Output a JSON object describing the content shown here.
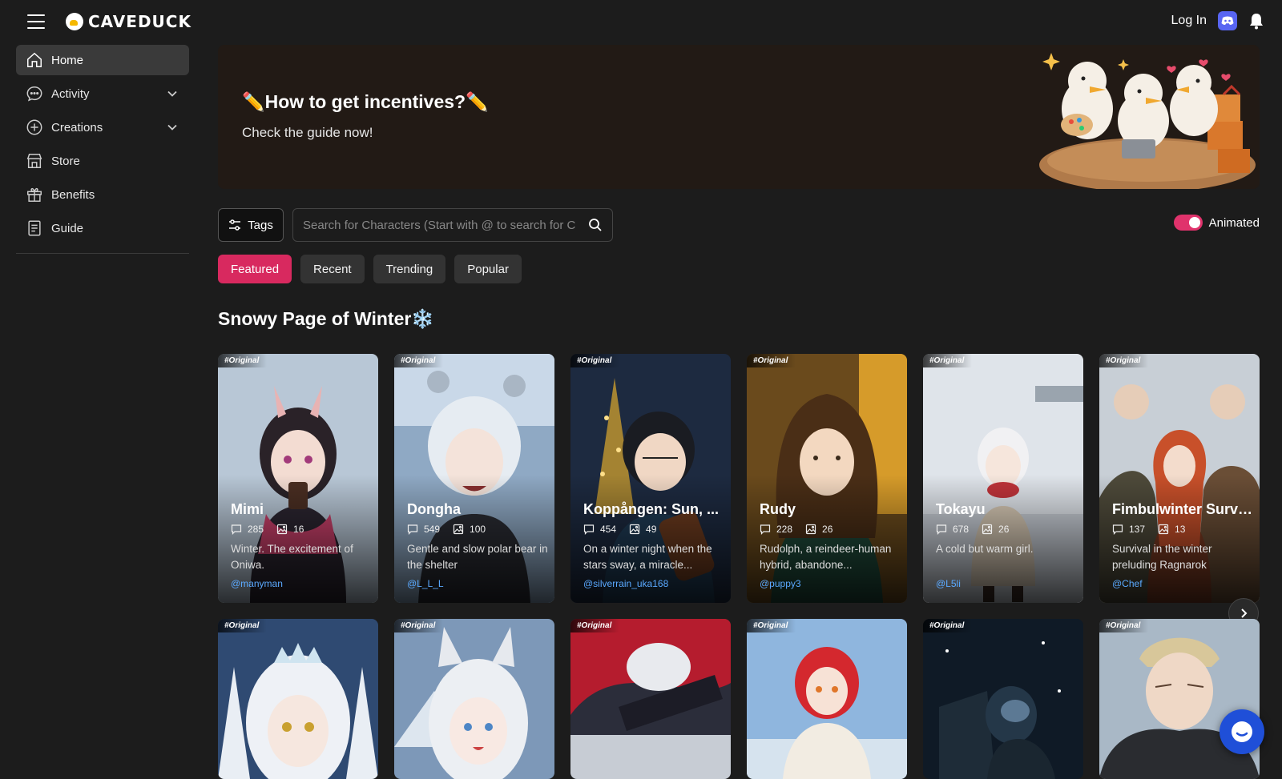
{
  "header": {
    "logo_text": "CAVEDUCK",
    "login_label": "Log In",
    "icons": [
      "menu-icon",
      "discord-icon",
      "bell-icon"
    ]
  },
  "sidebar": {
    "items": [
      {
        "label": "Home",
        "icon": "home-icon",
        "active": true
      },
      {
        "label": "Activity",
        "icon": "chat-bubble-icon",
        "expandable": true
      },
      {
        "label": "Creations",
        "icon": "plus-circle-icon",
        "expandable": true
      },
      {
        "label": "Store",
        "icon": "store-icon"
      },
      {
        "label": "Benefits",
        "icon": "gift-icon"
      },
      {
        "label": "Guide",
        "icon": "document-icon"
      }
    ]
  },
  "banner": {
    "title": "✏️How to get incentives?✏️",
    "subtitle": "Check the guide now!"
  },
  "controls": {
    "tags_label": "Tags",
    "search_placeholder": "Search for Characters (Start with @ to search for C",
    "animated_label": "Animated",
    "animated_on": true
  },
  "filters": [
    {
      "label": "Featured",
      "active": true
    },
    {
      "label": "Recent"
    },
    {
      "label": "Trending"
    },
    {
      "label": "Popular"
    }
  ],
  "section": {
    "title": "Snowy Page of Winter❄️"
  },
  "cards": [
    {
      "tag": "#Original",
      "name": "Mimi",
      "chats": "285",
      "images": "16",
      "desc": "Winter. The excitement of Oniwa.",
      "author": "@manyman"
    },
    {
      "tag": "#Original",
      "name": "Dongha",
      "chats": "549",
      "images": "100",
      "desc": "Gentle and slow polar bear in the shelter",
      "author": "@L_L_L"
    },
    {
      "tag": "#Original",
      "name": "Koppången: Sun, ...",
      "chats": "454",
      "images": "49",
      "desc": "On a winter night when the stars sway, a miracle...",
      "author": "@silverrain_uka168"
    },
    {
      "tag": "#Original",
      "name": "Rudy",
      "chats": "228",
      "images": "26",
      "desc": "Rudolph, a reindeer-human hybrid, abandone...",
      "author": "@puppy3"
    },
    {
      "tag": "#Original",
      "name": "Tokayu",
      "chats": "678",
      "images": "26",
      "desc": "A cold but warm girl.",
      "author": "@L5li"
    },
    {
      "tag": "#Original",
      "name": "Fimbulwinter Survi...",
      "chats": "137",
      "images": "13",
      "desc": "Survival in the winter preluding Ragnarok",
      "author": "@Chef"
    }
  ],
  "cards_row2": [
    {
      "tag": "#Original"
    },
    {
      "tag": "#Original"
    },
    {
      "tag": "#Original"
    },
    {
      "tag": "#Original"
    },
    {
      "tag": "#Original"
    },
    {
      "tag": "#Original"
    }
  ],
  "colors": {
    "accent": "#d8295f",
    "background": "#1c1c1c",
    "link": "#5aa9ff"
  }
}
